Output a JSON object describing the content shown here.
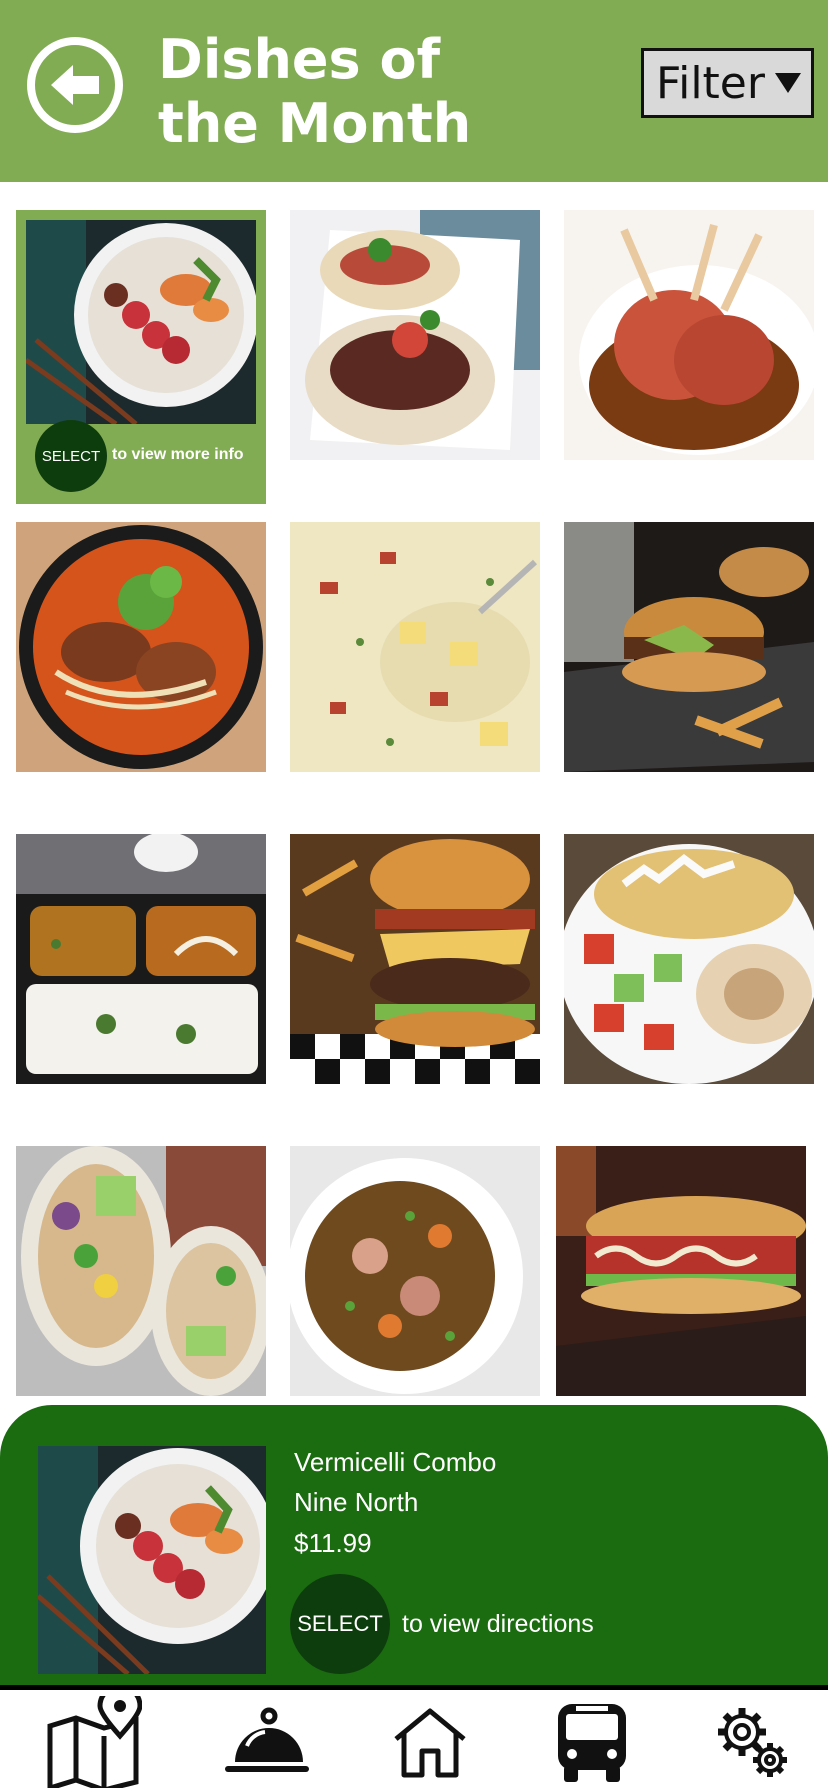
{
  "header": {
    "title": "Dishes of the Month",
    "filter_label": "Filter",
    "background_color": "#82ac53"
  },
  "grid": {
    "selected_hint": {
      "button_label": "SELECT",
      "hint_text": "to view more info"
    },
    "dishes": [
      {
        "depicts": "vermicelli combo bowl with grilled shrimp and meat",
        "selected": true
      },
      {
        "depicts": "steak tacos with pico de gallo"
      },
      {
        "depicts": "lamb chops in brown sauce"
      },
      {
        "depicts": "spicy noodle soup with cilantro"
      },
      {
        "depicts": "creamy potato chowder with bacon"
      },
      {
        "depicts": "burger with avocado and fries"
      },
      {
        "depicts": "curry and rice takeout tray"
      },
      {
        "depicts": "bacon cheeseburger with fries"
      },
      {
        "depicts": "rice plate with salad and hummus"
      },
      {
        "depicts": "burrito cut in half"
      },
      {
        "depicts": "stew in white bowl"
      },
      {
        "depicts": "toasted sub sandwich"
      }
    ]
  },
  "detail": {
    "dish_name": "Vermicelli Combo",
    "restaurant": "Nine North",
    "price": "$11.99",
    "button_label": "SELECT",
    "hint_text": "to view directions",
    "background_color": "#1b6b10"
  },
  "nav": {
    "items": [
      {
        "icon": "map-pin-icon"
      },
      {
        "icon": "food-cloche-icon"
      },
      {
        "icon": "home-icon"
      },
      {
        "icon": "bus-icon"
      },
      {
        "icon": "settings-gears-icon"
      }
    ]
  }
}
